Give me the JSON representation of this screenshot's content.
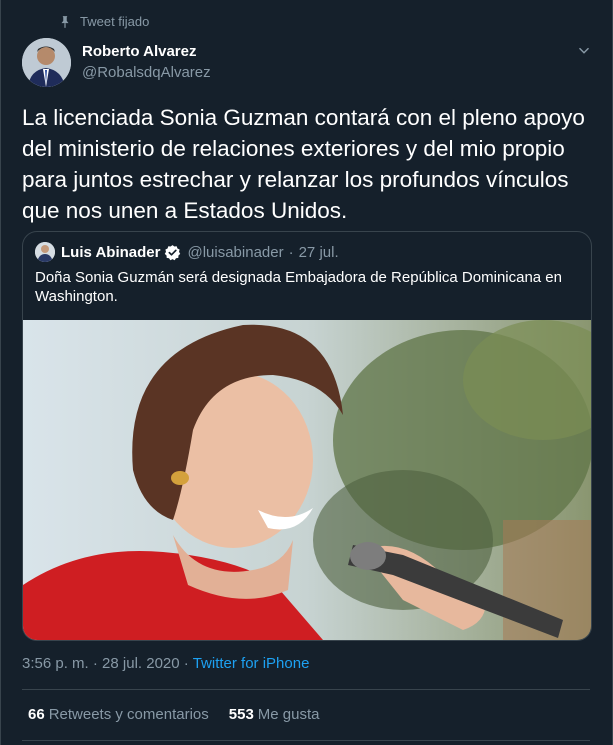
{
  "pinned_label": "Tweet fijado",
  "author": {
    "name": "Roberto Alvarez",
    "handle": "@RobalsdqAlvarez"
  },
  "tweet_text": "La licenciada Sonia Guzman contará con el pleno apoyo del ministerio de relaciones exteriores y del mio propio para juntos estrechar y relanzar los profundos vínculos que nos unen a Estados Unidos.",
  "quoted": {
    "name": "Luis Abinader",
    "handle": "@luisabinader",
    "separator": "·",
    "date": "27 jul.",
    "text": "Doña Sonia Guzmán será designada Embajadora de República Dominicana en Washington."
  },
  "meta": {
    "time": "3:56 p. m.",
    "separator": "·",
    "date": "28 jul. 2020",
    "source": "Twitter for iPhone"
  },
  "stats": {
    "retweets_count": "66",
    "retweets_label": "Retweets y comentarios",
    "likes_count": "553",
    "likes_label": "Me gusta"
  },
  "icons": {
    "pin": "pin-icon",
    "caret": "chevron-down-icon",
    "verified": "verified-badge-icon"
  },
  "colors": {
    "background": "#15202b",
    "border": "#38444d",
    "secondary_text": "#8899a6",
    "link": "#1da1f2"
  }
}
